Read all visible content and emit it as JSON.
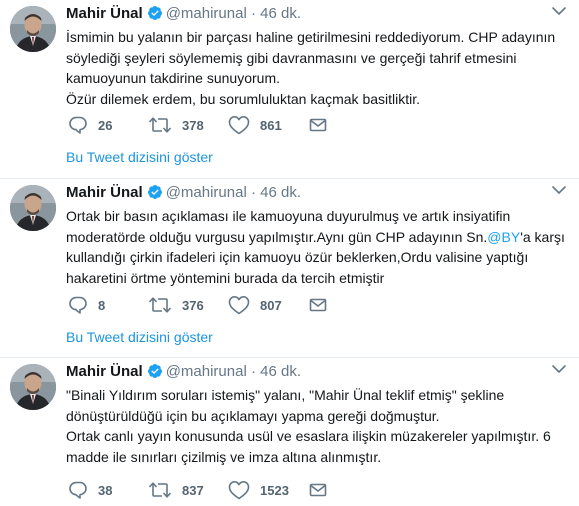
{
  "tweets": [
    {
      "name": "Mahir Ünal",
      "handle": "@mahirunal",
      "dot": "·",
      "time": "46 dk.",
      "lines": [
        "İsmimin bu yalanın bir parçası haline getirilmesini reddediyorum. CHP adayının",
        "söylediği şeyleri söylememiş gibi davranmasını ve gerçeği tahrif etmesini",
        "kamuoyunun takdirine sunuyorum.",
        "Özür dilemek erdem, bu sorumluluktan kaçmak basitliktir."
      ],
      "replies": "26",
      "retweets": "378",
      "likes": "861",
      "thread_link": "Bu Tweet dizisini göster"
    },
    {
      "name": "Mahir Ünal",
      "handle": "@mahirunal",
      "dot": "·",
      "time": "46 dk.",
      "line1": "Ortak bir basın açıklaması ile kamuoyuna duyurulmuş ve artık insiyatifin",
      "line2": "moderatörde olduğu vurgusu yapılmıştır.Aynı gün CHP adayının Sn.",
      "mention": "@BY",
      "line2_tail": "'a karşı",
      "line3": "kullandığı çirkin ifadeleri için kamuoyu özür beklerken,Ordu valisine yaptığı",
      "line4": "hakaretini örtme yöntemini burada da tercih etmiştir",
      "replies": "8",
      "retweets": "376",
      "likes": "807",
      "thread_link": "Bu Tweet dizisini göster"
    },
    {
      "name": "Mahir Ünal",
      "handle": "@mahirunal",
      "dot": "·",
      "time": "46 dk.",
      "lines": [
        "\"Binali Yıldırım soruları istemiş\" yalanı, \"Mahir Ünal teklif etmiş\" şekline",
        "dönüştürüldüğü için bu açıklamayı yapma gereği doğmuştur.",
        "Ortak canlı yayın konusunda usül ve esaslara ilişkin müzakereler yapılmıştır. 6",
        "madde ile sınırları çizilmiş ve imza altına alınmıştır."
      ],
      "replies": "38",
      "retweets": "837",
      "likes": "1523"
    }
  ],
  "icons": {
    "verified": "verified-badge-icon",
    "chevron": "chevron-down-icon",
    "reply": "reply-icon",
    "retweet": "retweet-icon",
    "like": "heart-icon",
    "dm": "envelope-icon"
  },
  "colors": {
    "link": "#1b95e0",
    "mention": "#1da1f2",
    "verified": "#1da1f2",
    "muted": "#657786",
    "divider": "#e6ecf0"
  }
}
